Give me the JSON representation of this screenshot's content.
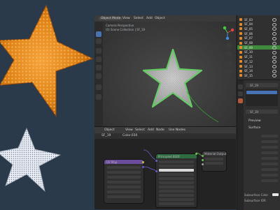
{
  "menu": {
    "mode": "Object Mode",
    "items": [
      "View",
      "Select",
      "Add",
      "Object"
    ]
  },
  "viewport": {
    "info_line1": "Camera Perspective",
    "info_line2": "(0) Scene Collection | SF_19"
  },
  "node_editor": {
    "header_items": [
      "Object",
      "View",
      "Select",
      "Add",
      "Node",
      "Use Nodes"
    ],
    "object_name": "SF_19",
    "material_name": "Color.030",
    "nodes": {
      "uv": {
        "title": "UV Map"
      },
      "bsdf": {
        "title": "Principled BSDF"
      },
      "output": {
        "title": "Material Output"
      }
    }
  },
  "outliner": {
    "rows": [
      "SF_03",
      "SF_04",
      "SF_05",
      "SF_06",
      "SF_07",
      "SF_08",
      "SF_09",
      "SF_10",
      "SF_11",
      "SF_12",
      "SF_13",
      "SF_14",
      "SF_15"
    ],
    "selected_index": 6
  },
  "properties": {
    "object_label": "SF_19",
    "material_label": "SF_19",
    "preview_label": "Preview",
    "surface_label": "Surface",
    "sss_color_label": "Subsurface Color",
    "sss_ior_label": "Subsurface IOR"
  },
  "colors": {
    "accent_selection": "#3e8b3e",
    "bsdf_header": "#2f6b3f",
    "orange_starfish": "#e38a1c"
  }
}
